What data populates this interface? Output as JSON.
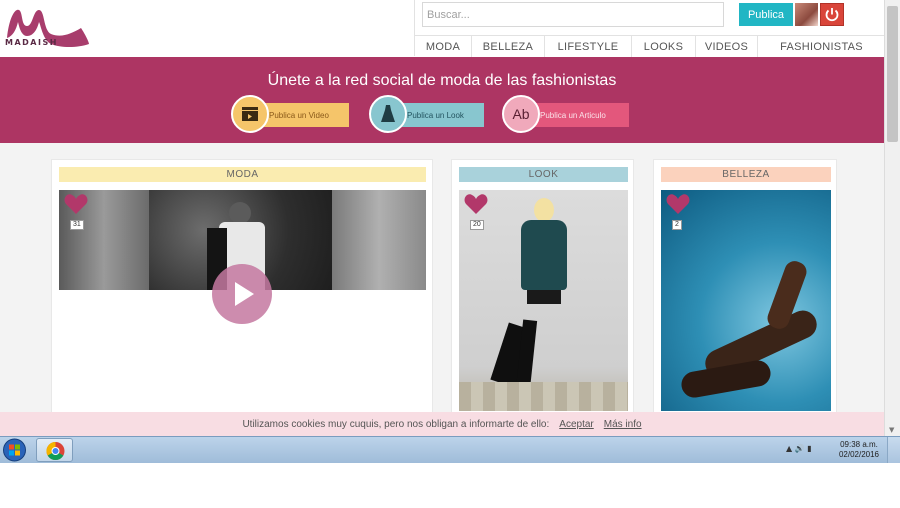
{
  "site": {
    "logo_text": "MADAISH",
    "search_placeholder": "Buscar...",
    "publica_label": "Publica",
    "nav": [
      "MODA",
      "BELLEZA",
      "LIFESTYLE",
      "LOOKS",
      "VIDEOS",
      "FASHIONISTAS"
    ]
  },
  "banner": {
    "title": "Únete a la red social de moda de las fashionistas",
    "actions": [
      {
        "label": "Publica un Video",
        "icon": "clapperboard-icon",
        "icon_glyph": "🎬"
      },
      {
        "label": "Publica un Look",
        "icon": "dress-icon",
        "icon_glyph": "👗"
      },
      {
        "label": "Publica un Articulo",
        "icon": "text-ab-icon",
        "icon_glyph": "Ab"
      }
    ]
  },
  "cards": [
    {
      "tag": "MODA",
      "likes": "31",
      "type": "video"
    },
    {
      "tag": "LOOK",
      "likes": "20",
      "type": "photo"
    },
    {
      "tag": "BELLEZA",
      "likes": "2",
      "type": "photo"
    }
  ],
  "cookie": {
    "text": "Utilizamos cookies muy cuquis, pero nos obligan a informarte de ello:",
    "accept": "Aceptar",
    "more": "Más info"
  },
  "taskbar": {
    "time": "09:38 a.m.",
    "date": "02/02/2016"
  },
  "colors": {
    "brand": "#ad3563",
    "teal": "#21b6c4",
    "moda_tag": "#faecb0",
    "look_tag": "#a9d2db",
    "belleza_tag": "#fbd2bd"
  }
}
